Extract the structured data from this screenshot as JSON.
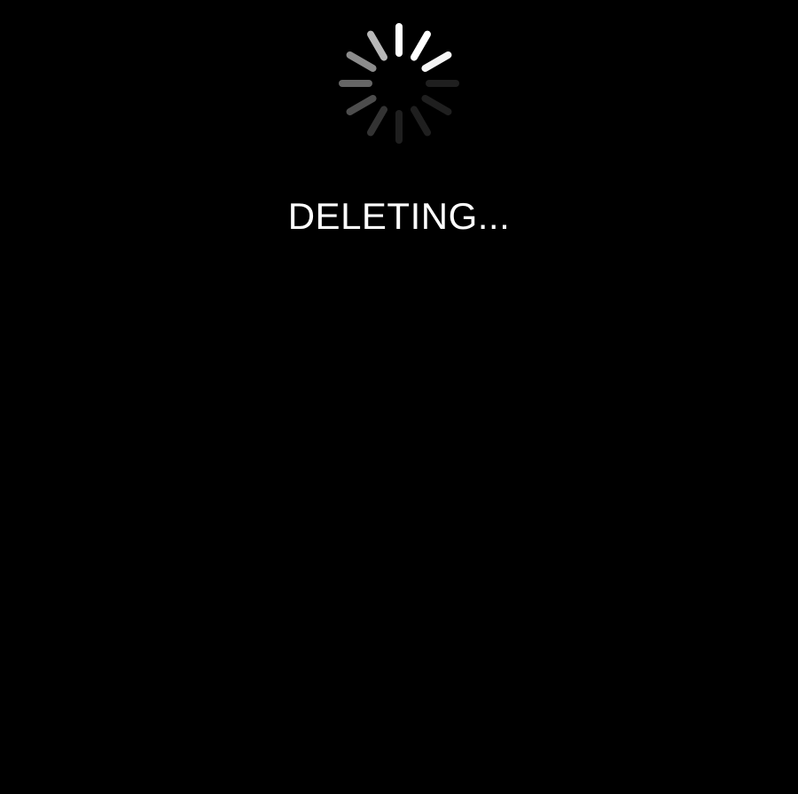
{
  "overlay": {
    "background_color": "#000000",
    "status_text": "DELETING...",
    "text_color": "#ffffff"
  },
  "spinner": {
    "icon": "loading-spinner-icon",
    "spoke_count": 12,
    "spoke_color": "#ffffff",
    "spoke_opacities": [
      1.0,
      1.0,
      0.96,
      0.12,
      0.12,
      0.12,
      0.12,
      0.2,
      0.3,
      0.4,
      0.55,
      0.72
    ]
  }
}
